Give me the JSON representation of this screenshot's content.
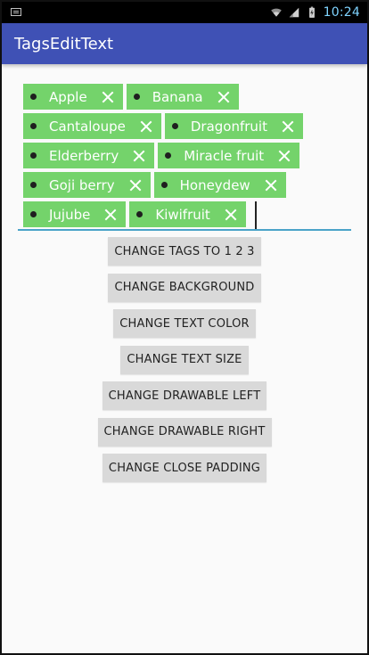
{
  "status_bar": {
    "time": "10:24"
  },
  "app_bar": {
    "title": "TagsEditText"
  },
  "tags": [
    {
      "label": "Apple"
    },
    {
      "label": "Banana"
    },
    {
      "label": "Cantaloupe"
    },
    {
      "label": "Dragonfruit"
    },
    {
      "label": "Elderberry"
    },
    {
      "label": "Miracle fruit"
    },
    {
      "label": "Goji berry"
    },
    {
      "label": "Honeydew"
    },
    {
      "label": "Jujube"
    },
    {
      "label": "Kiwifruit"
    }
  ],
  "buttons": {
    "change_tags": "CHANGE TAGS TO 1 2 3",
    "change_background": "CHANGE BACKGROUND",
    "change_text_color": "CHANGE TEXT COLOR",
    "change_text_size": "CHANGE TEXT SIZE",
    "change_drawable_left": "CHANGE DRAWABLE LEFT",
    "change_drawable_right": "CHANGE DRAWABLE RIGHT",
    "change_close_padding": "CHANGE CLOSE PADDING"
  },
  "colors": {
    "app_bar": "#3f51b5",
    "tag_bg": "#74d36b",
    "underline": "#4aa3c8",
    "button_bg": "#d9d9d9"
  }
}
